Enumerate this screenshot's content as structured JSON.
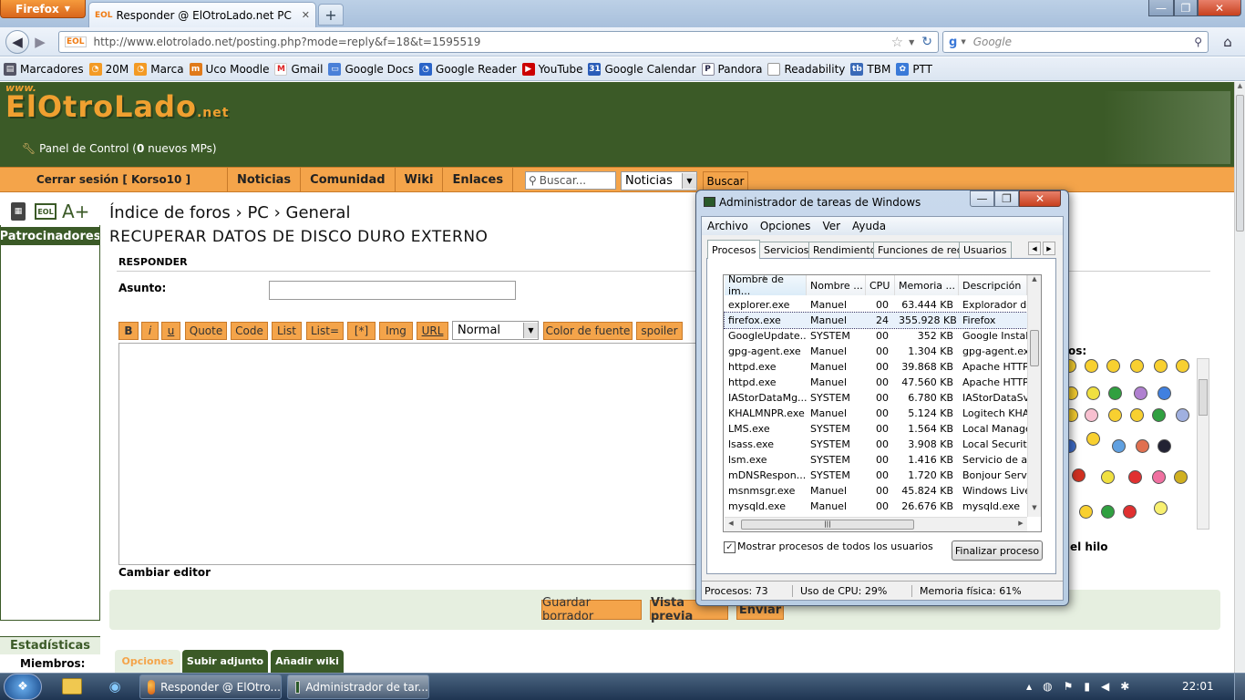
{
  "browser": {
    "menu_button": "Firefox",
    "tab_title": "Responder @ ElOtroLado.net PC",
    "new_tab": "+",
    "url": "http://www.elotrolado.net/posting.php?mode=reply&f=18&t=1595519",
    "search_placeholder": "Google",
    "bookmarks": [
      "Marcadores",
      "20M",
      "Marca",
      "Uco Moodle",
      "Gmail",
      "Google Docs",
      "Google Reader",
      "YouTube",
      "Google Calendar",
      "Pandora",
      "Readability",
      "TBM",
      "PTT"
    ]
  },
  "site": {
    "logo": "ElOtroLado",
    "logo_tld": ".net",
    "logo_www": "www.",
    "panel_prefix": "Panel de Control (",
    "panel_count": "0",
    "panel_suffix": " nuevos MPs)",
    "nav": [
      "Cerrar sesión [ Korso10 ]",
      "Noticias",
      "Comunidad",
      "Wiki",
      "Enlaces"
    ],
    "search_placeholder": "Buscar...",
    "search_scope": "Noticias",
    "search_button": "Buscar",
    "font_size_btn": "A+",
    "sponsors": "Patrocinadores",
    "breadcrumb": "Índice de foros › PC › General",
    "thread_title": "RECUPERAR DATOS DE DISCO DURO EXTERNO",
    "reply_heading": "RESPONDER",
    "subject_label": "Asunto:",
    "format_buttons": [
      "B",
      "i",
      "u",
      "Quote",
      "Code",
      "List",
      "List=",
      "[*]",
      "Img",
      "URL"
    ],
    "font_size_select": "Normal",
    "color_button": "Color de fuente",
    "spoiler_button": "spoiler",
    "change_editor": "Cambiar editor",
    "smileys_label": "os:",
    "thread_label": "el hilo",
    "save_draft": "Guardar borrador",
    "preview": "Vista previa",
    "send": "Enviar",
    "stats_title": "Estadísticas",
    "members_label": "Miembros:",
    "bottom_tabs": [
      "Opciones",
      "Subir adjunto",
      "Añadir wiki"
    ]
  },
  "task_manager": {
    "title": "Administrador de tareas de Windows",
    "menu": [
      "Archivo",
      "Opciones",
      "Ver",
      "Ayuda"
    ],
    "tabs": [
      "Procesos",
      "Servicios",
      "Rendimiento",
      "Funciones de red",
      "Usuarios"
    ],
    "columns": [
      "Nombre de im...",
      "Nombre ...",
      "CPU",
      "Memoria ...",
      "Descripción"
    ],
    "rows": [
      [
        "explorer.exe",
        "Manuel",
        "00",
        "63.444 KB",
        "Explorador de"
      ],
      [
        "firefox.exe",
        "Manuel",
        "24",
        "355.928 KB",
        "Firefox"
      ],
      [
        "GoogleUpdate...",
        "SYSTEM",
        "00",
        "352 KB",
        "Google Installe"
      ],
      [
        "gpg-agent.exe",
        "Manuel",
        "00",
        "1.304 KB",
        "gpg-agent.exe"
      ],
      [
        "httpd.exe",
        "Manuel",
        "00",
        "39.868 KB",
        "Apache HTTP S"
      ],
      [
        "httpd.exe",
        "Manuel",
        "00",
        "47.560 KB",
        "Apache HTTP S"
      ],
      [
        "IAStorDataMg...",
        "SYSTEM",
        "00",
        "6.780 KB",
        "IAStorDataSvc"
      ],
      [
        "KHALMNPR.exe",
        "Manuel",
        "00",
        "5.124 KB",
        "Logitech KHAL"
      ],
      [
        "LMS.exe",
        "SYSTEM",
        "00",
        "1.564 KB",
        "Local Manage"
      ],
      [
        "lsass.exe",
        "SYSTEM",
        "00",
        "3.908 KB",
        "Local Security"
      ],
      [
        "lsm.exe",
        "SYSTEM",
        "00",
        "1.416 KB",
        "Servicio de adm"
      ],
      [
        "mDNSRespon...",
        "SYSTEM",
        "00",
        "1.720 KB",
        "Bonjour Servic"
      ],
      [
        "msnmsgr.exe",
        "Manuel",
        "00",
        "45.824 KB",
        "Windows Live"
      ],
      [
        "mysqld.exe",
        "Manuel",
        "00",
        "26.676 KB",
        "mysqld.exe"
      ]
    ],
    "show_all_label": "Mostrar procesos de todos los usuarios",
    "end_process": "Finalizar proceso",
    "status_processes": "Procesos: 73",
    "status_cpu": "Uso de CPU: 29%",
    "status_memory": "Memoria física: 61%"
  },
  "taskbar": {
    "items": [
      "Responder @ ElOtro...",
      "Administrador de tar..."
    ],
    "clock": "22:01"
  }
}
